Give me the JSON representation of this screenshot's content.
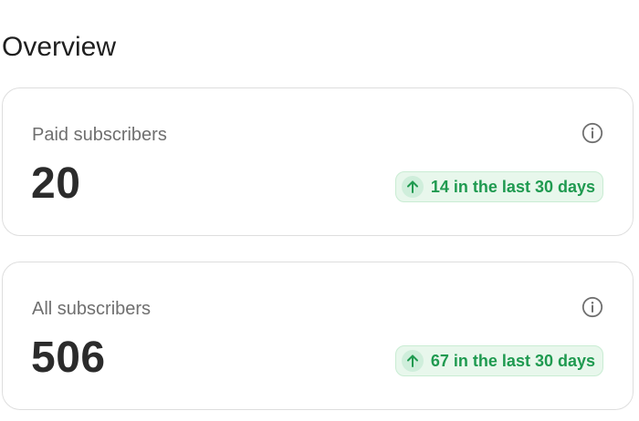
{
  "overview": {
    "title": "Overview",
    "cards": [
      {
        "label": "Paid subscribers",
        "value": "20",
        "trend_text": "14 in the last 30 days",
        "trend_direction": "up",
        "icon": "info-icon"
      },
      {
        "label": "All subscribers",
        "value": "506",
        "trend_text": "67 in the last 30 days",
        "trend_direction": "up",
        "icon": "info-icon"
      }
    ]
  },
  "colors": {
    "trend_positive_text": "#1f9a50",
    "trend_positive_background": "#e8f7ec",
    "card_border": "#dedede",
    "label_text": "#6f6f6f",
    "value_text": "#2b2b2b"
  }
}
